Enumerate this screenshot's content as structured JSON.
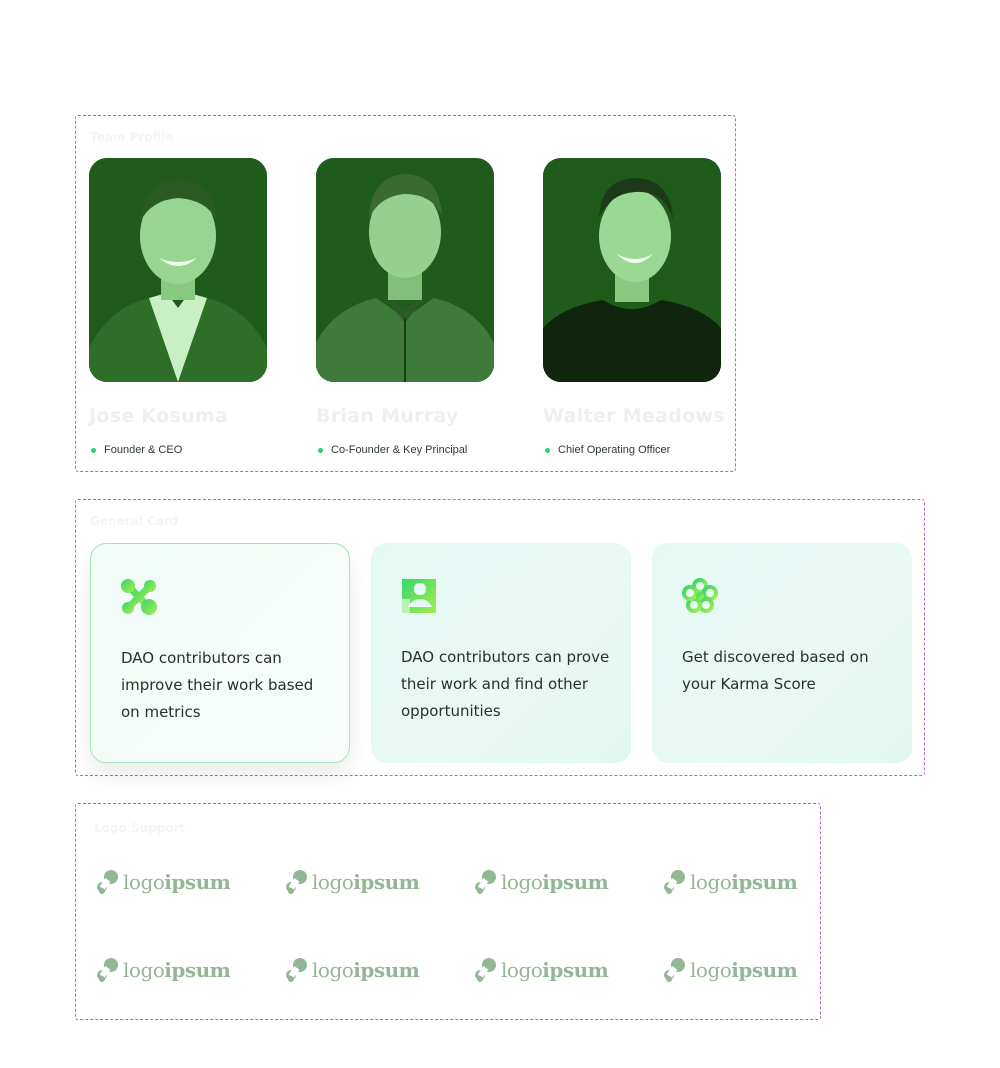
{
  "team_profile": {
    "frame_label": "Team Profile",
    "members": [
      {
        "name": "Jose Kosuma",
        "role": "Founder & CEO"
      },
      {
        "name": "Brian Murray",
        "role": "Co-Founder & Key Principal"
      },
      {
        "name": "Walter Meadows",
        "role": "Chief Operating Officer"
      }
    ]
  },
  "general_card": {
    "frame_label": "General Card",
    "cards": [
      {
        "icon": "molecule-icon",
        "text": "DAO contributors can improve their work based on metrics"
      },
      {
        "icon": "puzzle-person-icon",
        "text": "DAO contributors can prove their work and find other opportunities"
      },
      {
        "icon": "flower-icon",
        "text": "Get discovered based on your Karma Score"
      }
    ],
    "accent_color": "#2ad26a"
  },
  "logo_support": {
    "frame_label": "Logo Support",
    "logos": [
      {
        "part1": "logo",
        "part2": "ipsum"
      },
      {
        "part1": "logo",
        "part2": "ipsum"
      },
      {
        "part1": "logo",
        "part2": "ipsum"
      },
      {
        "part1": "logo",
        "part2": "ipsum"
      },
      {
        "part1": "logo",
        "part2": "ipsum"
      },
      {
        "part1": "logo",
        "part2": "ipsum"
      },
      {
        "part1": "logo",
        "part2": "ipsum"
      },
      {
        "part1": "logo",
        "part2": "ipsum"
      }
    ],
    "logo_color": "#93b794"
  }
}
